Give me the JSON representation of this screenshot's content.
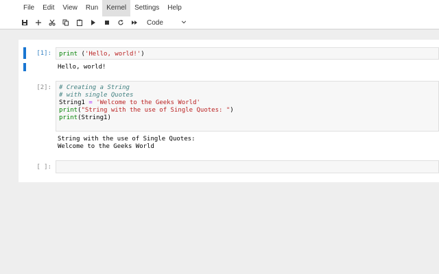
{
  "menu": {
    "items": [
      "File",
      "Edit",
      "View",
      "Run",
      "Kernel",
      "Settings",
      "Help"
    ],
    "active_index": 4
  },
  "toolbar": {
    "cell_type": "Code",
    "icons": [
      "save-icon",
      "add-icon",
      "cut-icon",
      "copy-icon",
      "paste-icon",
      "run-icon",
      "stop-icon",
      "restart-icon",
      "fast-forward-icon"
    ]
  },
  "cells": [
    {
      "prompt": "[1]:",
      "code": [
        [
          {
            "t": "print",
            "c": "kw"
          },
          {
            "t": " (",
            "c": "plain"
          },
          {
            "t": "'Hello, world!'",
            "c": "str"
          },
          {
            "t": ")",
            "c": "plain"
          }
        ]
      ],
      "output": [
        "Hello, world!"
      ]
    },
    {
      "prompt": "[2]:",
      "code": [
        [
          {
            "t": "# Creating a String",
            "c": "cmt"
          }
        ],
        [
          {
            "t": "# with single Quotes",
            "c": "cmt"
          }
        ],
        [
          {
            "t": "String1 ",
            "c": "plain"
          },
          {
            "t": "=",
            "c": "op"
          },
          {
            "t": " ",
            "c": "plain"
          },
          {
            "t": "'Welcome to the Geeks World'",
            "c": "str"
          }
        ],
        [
          {
            "t": "print",
            "c": "kw"
          },
          {
            "t": "(",
            "c": "plain"
          },
          {
            "t": "\"String with the use of Single Quotes: \"",
            "c": "str"
          },
          {
            "t": ")",
            "c": "plain"
          }
        ],
        [
          {
            "t": "print",
            "c": "kw"
          },
          {
            "t": "(String1)",
            "c": "plain"
          }
        ]
      ],
      "output": [
        "String with the use of Single Quotes:",
        "Welcome to the Geeks World"
      ]
    },
    {
      "prompt": "[ ]:",
      "code": [],
      "output": []
    }
  ],
  "colors": {
    "accent": "#1976d2",
    "keyword": "#008000",
    "string": "#ba2121",
    "comment": "#408080"
  }
}
